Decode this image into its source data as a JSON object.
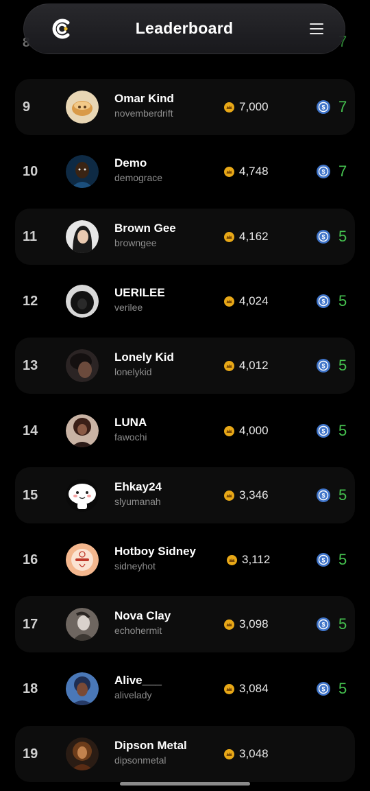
{
  "header": {
    "title": "Leaderboard",
    "logo_icon": "app-logo-icon",
    "menu_icon": "hamburger-menu-icon"
  },
  "partial_row": {
    "rank": "8",
    "reward": "7"
  },
  "rows": [
    {
      "rank": "9",
      "name": "Omar Kind",
      "username": "novemberdrift",
      "points": "7,000",
      "reward": "7"
    },
    {
      "rank": "10",
      "name": "Demo",
      "username": "demograce",
      "points": "4,748",
      "reward": "7"
    },
    {
      "rank": "11",
      "name": "Brown Gee",
      "username": "browngee",
      "points": "4,162",
      "reward": "5"
    },
    {
      "rank": "12",
      "name": "UERILEE",
      "username": "verilee",
      "points": "4,024",
      "reward": "5"
    },
    {
      "rank": "13",
      "name": "Lonely Kid",
      "username": "lonelykid",
      "points": "4,012",
      "reward": "5"
    },
    {
      "rank": "14",
      "name": "LUNA",
      "username": "fawochi",
      "points": "4,000",
      "reward": "5"
    },
    {
      "rank": "15",
      "name": "Ehkay24",
      "username": "slyumanah",
      "points": "3,346",
      "reward": "5"
    },
    {
      "rank": "16",
      "name": "Hotboy Sidney",
      "username": "sidneyhot",
      "points": "3,112",
      "reward": "5"
    },
    {
      "rank": "17",
      "name": "Nova Clay",
      "username": "echohermit",
      "points": "3,098",
      "reward": "5"
    },
    {
      "rank": "18",
      "name": "Alive___",
      "username": "alivelady",
      "points": "3,084",
      "reward": "5"
    },
    {
      "rank": "19",
      "name": "Dipson Metal",
      "username": "dipsonmetal",
      "points": "3,048",
      "reward": ""
    }
  ],
  "colors": {
    "reward_green": "#45c24f",
    "coin_gold": "#e8a817",
    "usdc_blue": "#3f74c9",
    "row_alt_bg": "#0d0d0d"
  }
}
